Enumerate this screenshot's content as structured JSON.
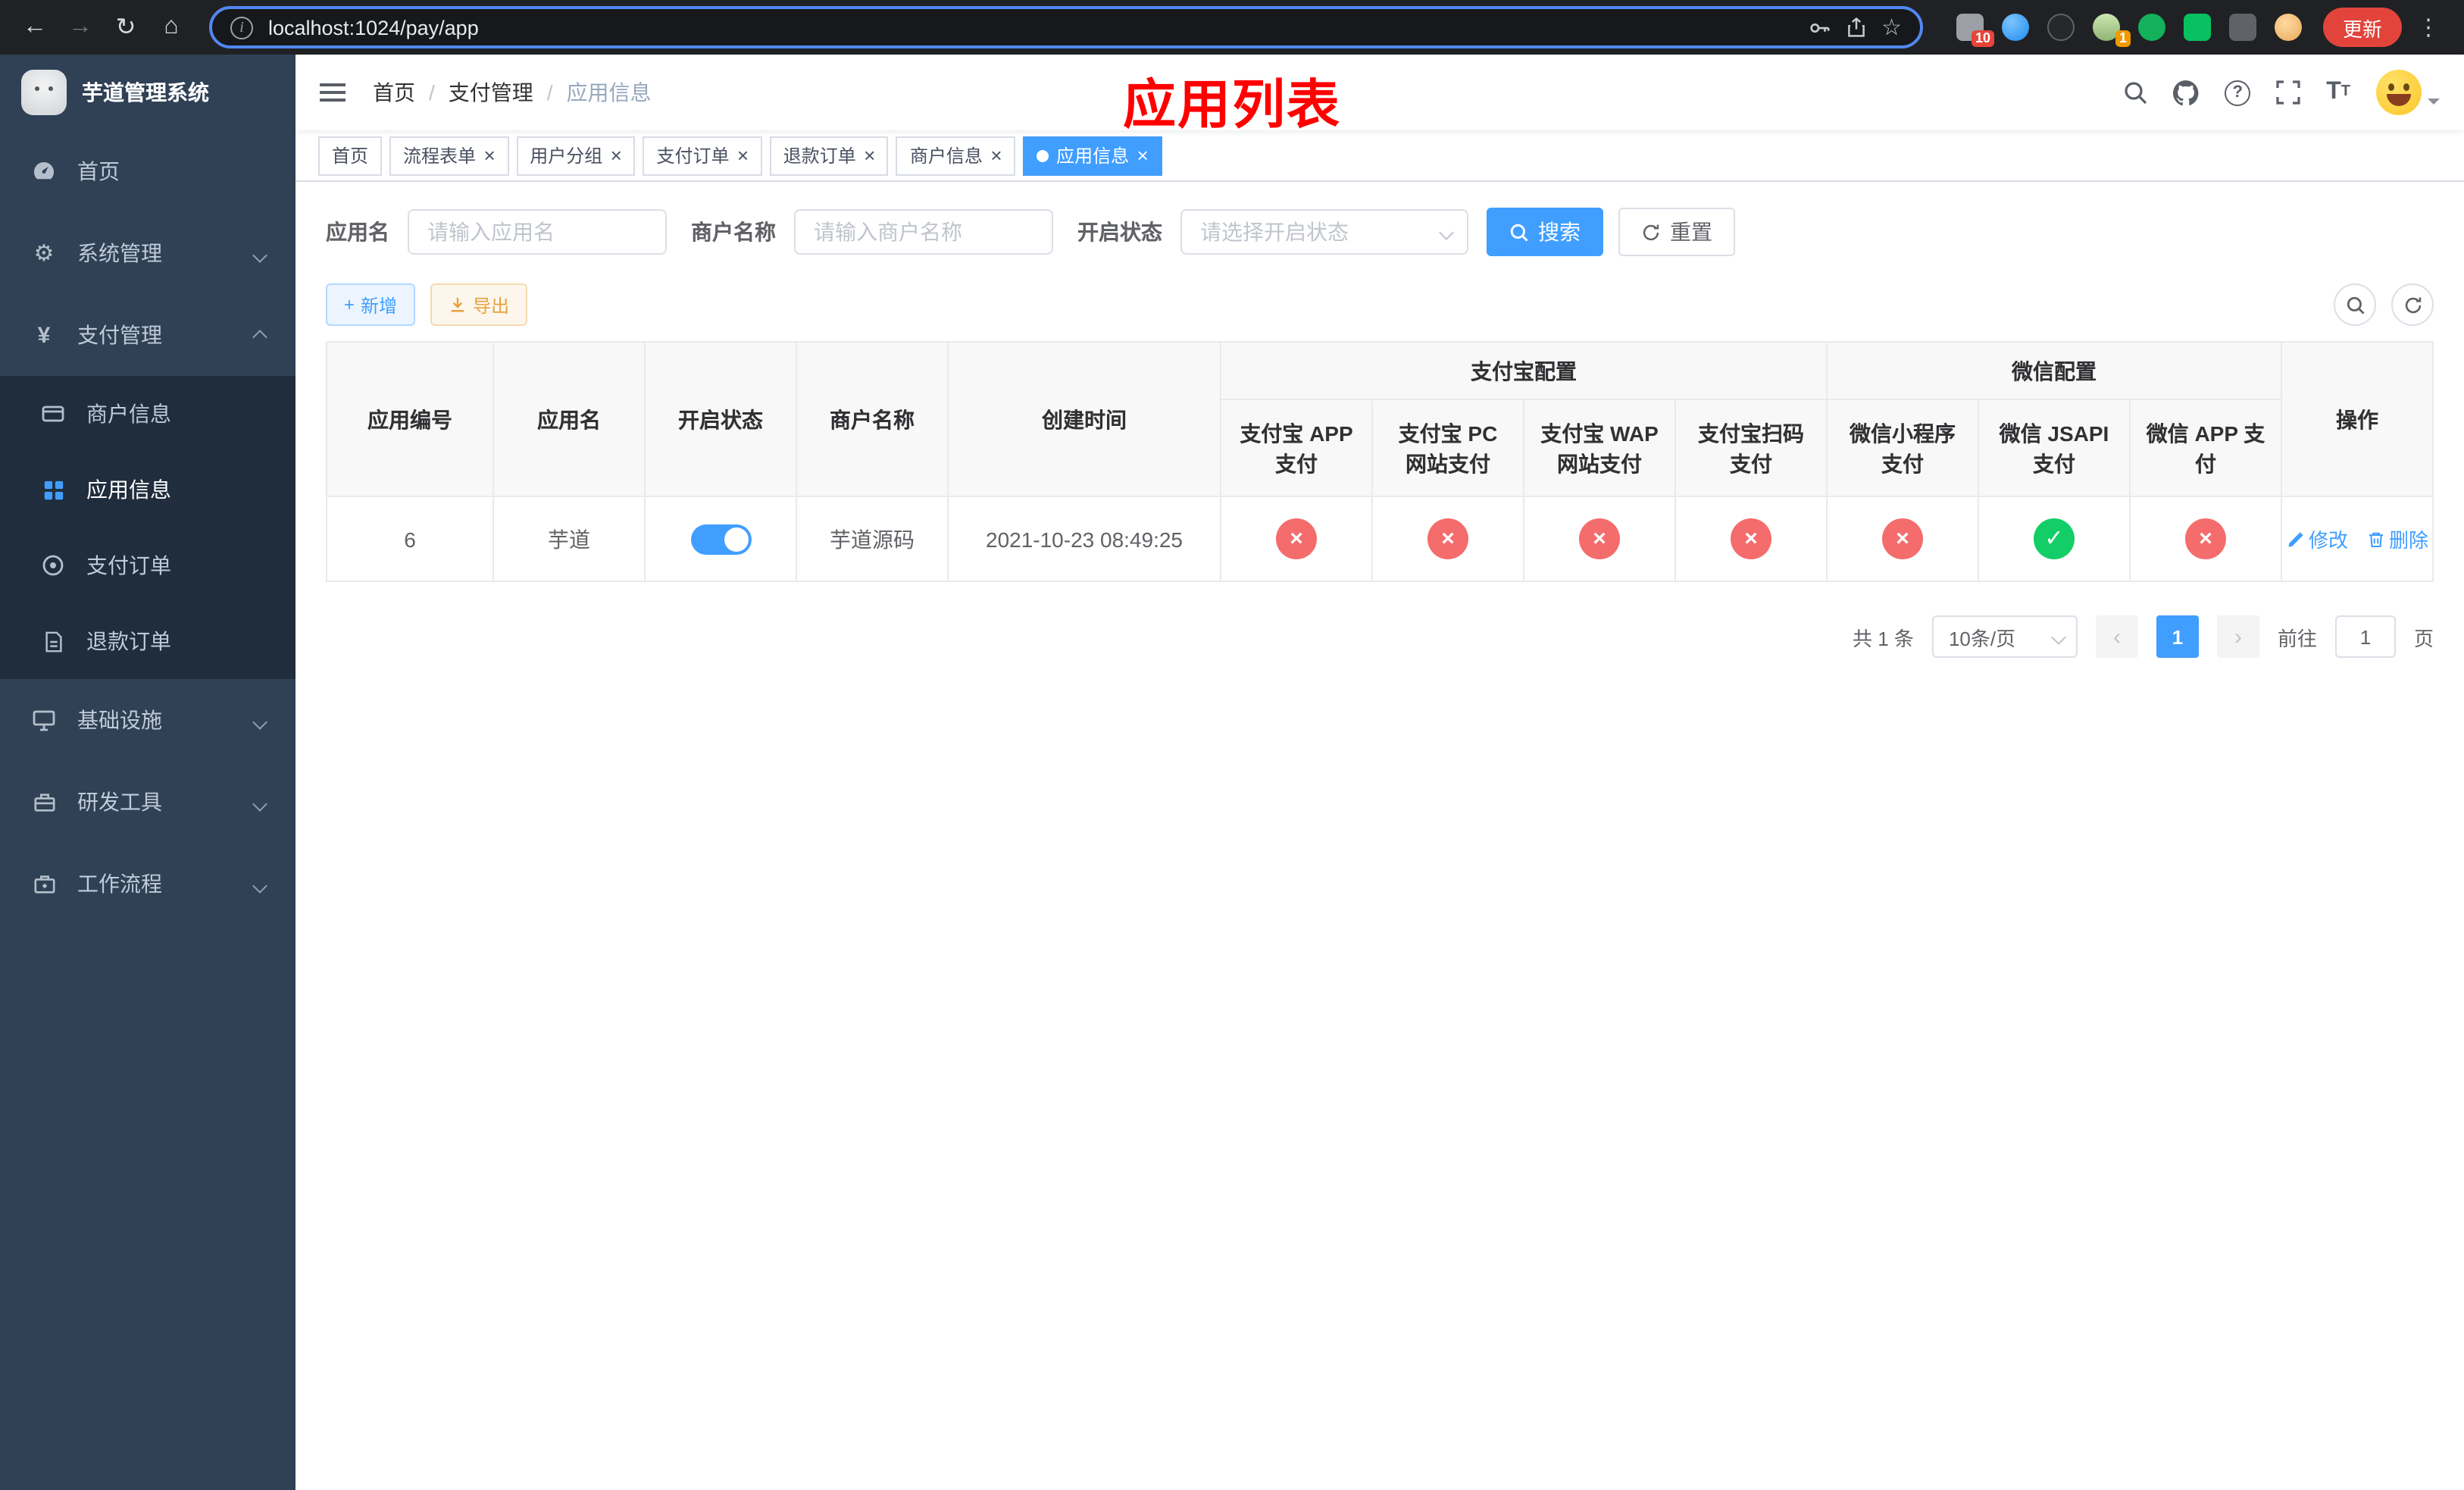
{
  "overlay_title": "应用列表",
  "browser": {
    "url": "localhost:1024/pay/app",
    "update_button": "更新",
    "ext_badge_count": "10",
    "profile_badge_count": "1"
  },
  "sidebar": {
    "title": "芋道管理系统",
    "items": [
      {
        "label": "首页"
      },
      {
        "label": "系统管理"
      },
      {
        "label": "支付管理"
      },
      {
        "label": "商户信息"
      },
      {
        "label": "应用信息"
      },
      {
        "label": "支付订单"
      },
      {
        "label": "退款订单"
      },
      {
        "label": "基础设施"
      },
      {
        "label": "研发工具"
      },
      {
        "label": "工作流程"
      }
    ]
  },
  "breadcrumb": {
    "separator": "/",
    "items": [
      "首页",
      "支付管理",
      "应用信息"
    ]
  },
  "tabs": [
    {
      "label": "首页"
    },
    {
      "label": "流程表单"
    },
    {
      "label": "用户分组"
    },
    {
      "label": "支付订单"
    },
    {
      "label": "退款订单"
    },
    {
      "label": "商户信息"
    },
    {
      "label": "应用信息"
    }
  ],
  "filters": {
    "app_name_label": "应用名",
    "app_name_placeholder": "请输入应用名",
    "merchant_label": "商户名称",
    "merchant_placeholder": "请输入商户名称",
    "status_label": "开启状态",
    "status_placeholder": "请选择开启状态",
    "search_button": "搜索",
    "reset_button": "重置"
  },
  "toolbar": {
    "add_button": "新增",
    "export_button": "导出"
  },
  "table": {
    "groups": {
      "alipay": "支付宝配置",
      "wechat": "微信配置"
    },
    "columns": {
      "id": "应用编号",
      "name": "应用名",
      "status": "开启状态",
      "merchant": "商户名称",
      "created": "创建时间",
      "alipay_app": "支付宝 APP 支付",
      "alipay_pc": "支付宝 PC 网站支付",
      "alipay_wap": "支付宝 WAP 网站支付",
      "alipay_qr": "支付宝扫码支付",
      "wx_mini": "微信小程序支付",
      "wx_jsapi": "微信 JSAPI 支付",
      "wx_app": "微信 APP 支付",
      "actions": "操作"
    },
    "row": {
      "id": "6",
      "name": "芋道",
      "status_on": true,
      "merchant": "芋道源码",
      "created": "2021-10-23 08:49:25",
      "configs": [
        "no",
        "no",
        "no",
        "no",
        "no",
        "yes",
        "no"
      ],
      "edit_label": "修改",
      "delete_label": "删除"
    }
  },
  "pagination": {
    "total": "共 1 条",
    "page_size": "10条/页",
    "current_page": "1",
    "goto_label": "前往",
    "goto_value": "1",
    "goto_unit": "页"
  },
  "colors": {
    "primary": "#409eff",
    "success": "#13ce66",
    "danger": "#f56c6c",
    "warning": "#e6a23c",
    "sidebar_bg": "#304156",
    "submenu_bg": "#1f2d3d",
    "overlay_title": "#ff0000",
    "update_button_bg": "#e2443b"
  }
}
